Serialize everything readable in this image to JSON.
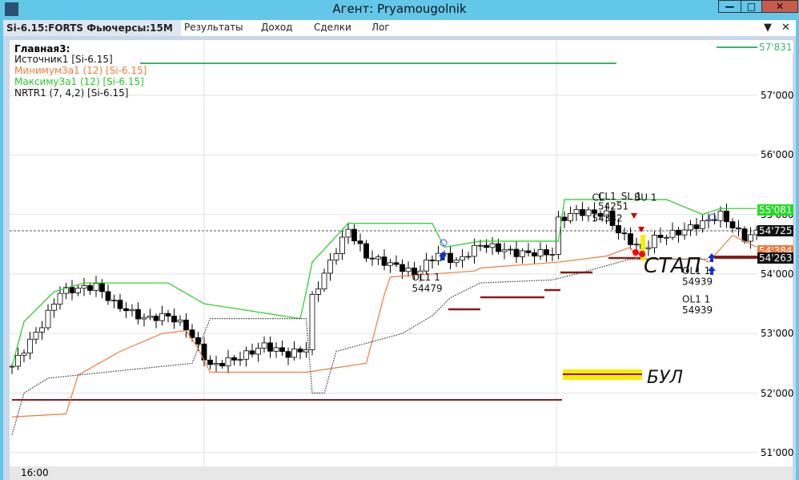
{
  "window": {
    "title": "Агент: Pryamougolnik"
  },
  "tabs": [
    {
      "label": "Si-6.15:FORTS Фьючерсы:15M"
    },
    {
      "label": "Результаты"
    },
    {
      "label": "Доход"
    },
    {
      "label": "Сделки"
    },
    {
      "label": "Лог"
    }
  ],
  "legend": {
    "title": "Главная3:",
    "items": [
      {
        "label": "Источник1 [Si-6.15]",
        "color": "#111111"
      },
      {
        "label": "МинимумЗа1 (12) [Si-6.15]",
        "color": "#f07a3a"
      },
      {
        "label": "МаксимуЗа1 (12) [Si-6.15]",
        "color": "#22cc22"
      },
      {
        "label": "NRTR1 (7, 4,2) [Si-6.15]",
        "color": "#111111"
      }
    ]
  },
  "price_axis": {
    "ticks": [
      "57'000",
      "56'000",
      "55'000",
      "54'000",
      "53'000",
      "52'000",
      "51'000"
    ],
    "tick_values": [
      57000,
      56000,
      55000,
      54000,
      53000,
      52000,
      51000
    ],
    "markers": [
      {
        "label": "57'831",
        "value": 57831,
        "bg": "#ffffff",
        "fg": "#3cb371"
      },
      {
        "label": "55'081",
        "value": 55081,
        "bg": "#22dd22",
        "fg": "#ffffff"
      },
      {
        "label": "54'725",
        "value": 54725,
        "bg": "#111111",
        "fg": "#ffffff"
      },
      {
        "label": "54'384",
        "value": 54384,
        "bg": "#f07a3a",
        "fg": "#ffffff"
      },
      {
        "label": "54'263",
        "value": 54263,
        "bg": "#111111",
        "fg": "#ffffff"
      }
    ]
  },
  "time_axis": {
    "label": "16:00"
  },
  "price_path": [
    [
      0,
      52450
    ],
    [
      5,
      53150
    ],
    [
      8,
      53700
    ],
    [
      14,
      53800
    ],
    [
      17,
      53500
    ],
    [
      22,
      53250
    ],
    [
      26,
      53300
    ],
    [
      29,
      53100
    ],
    [
      33,
      52450
    ],
    [
      38,
      52600
    ],
    [
      42,
      52800
    ],
    [
      46,
      52650
    ],
    [
      49,
      52750
    ],
    [
      50,
      53600
    ],
    [
      54,
      54400
    ],
    [
      56,
      54750
    ],
    [
      59,
      54300
    ],
    [
      65,
      54100
    ],
    [
      67,
      54000
    ],
    [
      71,
      54350
    ],
    [
      74,
      54200
    ],
    [
      78,
      54500
    ],
    [
      84,
      54350
    ],
    [
      90,
      54350
    ],
    [
      91,
      54900
    ],
    [
      94,
      55050
    ],
    [
      99,
      55000
    ],
    [
      101,
      54700
    ],
    [
      105,
      54400
    ],
    [
      107,
      54600
    ],
    [
      111,
      54700
    ],
    [
      116,
      54900
    ],
    [
      118,
      55000
    ],
    [
      122,
      54600
    ],
    [
      124,
      54700
    ]
  ],
  "max_line": [
    [
      0,
      52450
    ],
    [
      2,
      53200
    ],
    [
      7,
      53700
    ],
    [
      12,
      53850
    ],
    [
      26,
      53850
    ],
    [
      32,
      53500
    ],
    [
      48,
      53250
    ],
    [
      49,
      53700
    ],
    [
      50,
      54200
    ],
    [
      56,
      54850
    ],
    [
      70,
      54850
    ],
    [
      72,
      54450
    ],
    [
      78,
      54550
    ],
    [
      91,
      54550
    ],
    [
      92,
      55250
    ],
    [
      109,
      55250
    ],
    [
      115,
      55000
    ],
    [
      118,
      55100
    ],
    [
      124,
      55100
    ]
  ],
  "min_line": [
    [
      0,
      51600
    ],
    [
      9,
      51650
    ],
    [
      11,
      52300
    ],
    [
      18,
      52700
    ],
    [
      25,
      53000
    ],
    [
      29,
      53050
    ],
    [
      31,
      52750
    ],
    [
      33,
      52350
    ],
    [
      49,
      52350
    ],
    [
      59,
      52500
    ],
    [
      62,
      53650
    ],
    [
      63,
      53950
    ],
    [
      77,
      54050
    ],
    [
      78,
      54100
    ],
    [
      91,
      54200
    ],
    [
      99,
      54300
    ],
    [
      103,
      54450
    ],
    [
      104,
      54250
    ],
    [
      115,
      54250
    ],
    [
      116,
      54200
    ],
    [
      120,
      54650
    ],
    [
      124,
      54450
    ]
  ],
  "nrtr_line": [
    [
      0,
      51300
    ],
    [
      2,
      52000
    ],
    [
      6,
      52250
    ],
    [
      30,
      52500
    ],
    [
      33,
      53250
    ],
    [
      49,
      53250
    ],
    [
      50,
      52000
    ],
    [
      52,
      52000
    ],
    [
      54,
      52700
    ],
    [
      65,
      53000
    ],
    [
      70,
      53300
    ],
    [
      73,
      53600
    ],
    [
      78,
      53850
    ],
    [
      90,
      53900
    ],
    [
      94,
      54000
    ],
    [
      103,
      54250
    ],
    [
      116,
      54250
    ]
  ],
  "annotations": [
    {
      "text": "CL1_SL 1",
      "value": 55250,
      "bar": 100
    },
    {
      "text": "54251",
      "value": 55080,
      "bar": 100
    },
    {
      "text": "CL",
      "value": 55230,
      "bar": 99
    },
    {
      "text": "54332",
      "value": 54880,
      "bar": 99
    },
    {
      "text": "BU 1",
      "value": 55230,
      "bar": 106
    },
    {
      "text": "OL1 1",
      "value": 53890,
      "bar": 69
    },
    {
      "text": "54479",
      "value": 53700,
      "bar": 69
    },
    {
      "text": "OL1 1",
      "value": 54000,
      "bar": 114
    },
    {
      "text": "54939",
      "value": 53820,
      "bar": 114
    },
    {
      "text": "OL1 1",
      "value": 53520,
      "bar": 114
    },
    {
      "text": "54939",
      "value": 53340,
      "bar": 114
    }
  ],
  "handwritten": [
    "СТАП",
    "БУЛ"
  ],
  "colors": {
    "up": "#ffffff",
    "down": "#000000",
    "max": "#22cc22",
    "min": "#f07a3a",
    "level": "#8b1a1a",
    "top": "#3cb371"
  }
}
